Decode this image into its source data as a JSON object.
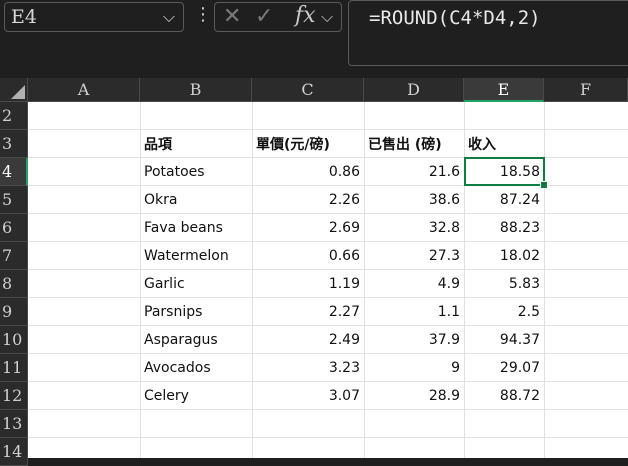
{
  "name_box": {
    "value": "E4"
  },
  "formula_bar": {
    "formula": "=ROUND(C4*D4,2)",
    "cancel_icon": "✕",
    "enter_icon": "✓",
    "fx_label": "fx"
  },
  "columns": [
    "A",
    "B",
    "C",
    "D",
    "E",
    "F"
  ],
  "rows": [
    "2",
    "3",
    "4",
    "5",
    "6",
    "7",
    "8",
    "9",
    "10",
    "11",
    "12",
    "13",
    "14"
  ],
  "headers": {
    "item": "品項",
    "price": "單價(元/磅)",
    "sold": "已售出 (磅)",
    "revenue": "收入"
  },
  "table": [
    {
      "item": "Potatoes",
      "price": "0.86",
      "sold": "21.6",
      "revenue": "18.58"
    },
    {
      "item": "Okra",
      "price": "2.26",
      "sold": "38.6",
      "revenue": "87.24"
    },
    {
      "item": "Fava beans",
      "price": "2.69",
      "sold": "32.8",
      "revenue": "88.23"
    },
    {
      "item": "Watermelon",
      "price": "0.66",
      "sold": "27.3",
      "revenue": "18.02"
    },
    {
      "item": "Garlic",
      "price": "1.19",
      "sold": "4.9",
      "revenue": "5.83"
    },
    {
      "item": "Parsnips",
      "price": "2.27",
      "sold": "1.1",
      "revenue": "2.5"
    },
    {
      "item": "Asparagus",
      "price": "2.49",
      "sold": "37.9",
      "revenue": "94.37"
    },
    {
      "item": "Avocados",
      "price": "3.23",
      "sold": "9",
      "revenue": "29.07"
    },
    {
      "item": "Celery",
      "price": "3.07",
      "sold": "28.9",
      "revenue": "88.72"
    }
  ],
  "selection": {
    "column": "E",
    "row": "4"
  },
  "colors": {
    "accent": "#107c41",
    "header_bg": "#2b2b2b",
    "grid_line": "#e1e1e1"
  }
}
